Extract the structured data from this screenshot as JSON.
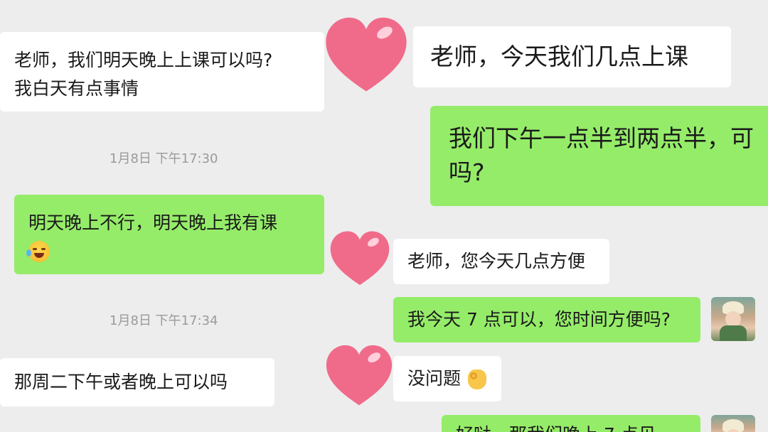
{
  "left": {
    "messages": [
      {
        "lines": [
          "老师，我们明天晚上上课可以吗?",
          "我白天有点事情"
        ]
      },
      {
        "timestamp": "1月8日 下午17:30"
      },
      {
        "lines": [
          "明天晚上不行，明天晚上我有课"
        ],
        "emoji": "laughing-tears"
      },
      {
        "timestamp": "1月8日 下午17:34"
      },
      {
        "lines": [
          "那周二下午或者晚上可以吗"
        ]
      }
    ]
  },
  "right": {
    "msg1": "老师，今天我们几点上课",
    "msg2_line1": "我们下午一点半到两点半，可",
    "msg2_line2": "吗?",
    "msg3": "老师，您今天几点方便",
    "msg4": "我今天 7 点可以，您时间方便吗?",
    "msg5": "没问题",
    "msg5_emoji": "ok-hand",
    "msg6_partial": "好哒，那我们晚上 7 点见"
  },
  "colors": {
    "background": "#ededed",
    "incoming_bubble": "#ffffff",
    "outgoing_bubble": "#95ec69",
    "timestamp_text": "#9a9a9a",
    "heart": "#f06b8a"
  }
}
